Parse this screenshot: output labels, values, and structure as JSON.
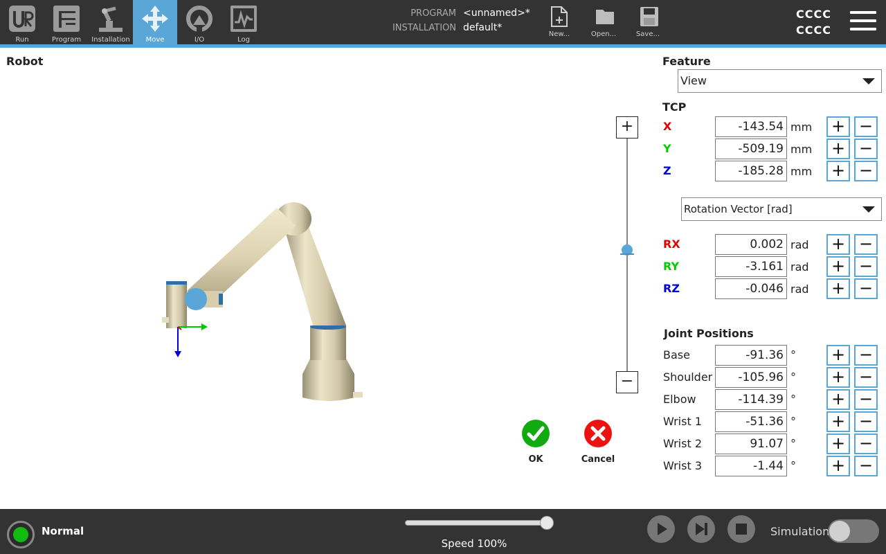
{
  "nav": {
    "items": [
      {
        "label": "Run"
      },
      {
        "label": "Program"
      },
      {
        "label": "Installation"
      },
      {
        "label": "Move"
      },
      {
        "label": "I/O"
      },
      {
        "label": "Log"
      }
    ]
  },
  "header": {
    "program_key": "PROGRAM",
    "program_value": "<unnamed>*",
    "installation_key": "INSTALLATION",
    "installation_value": "default*",
    "file_buttons": [
      {
        "label": "New..."
      },
      {
        "label": "Open..."
      },
      {
        "label": "Save..."
      }
    ],
    "user_line1": "CCCC",
    "user_line2": "CCCC"
  },
  "robot": {
    "title": "Robot"
  },
  "actions": {
    "ok_label": "OK",
    "cancel_label": "Cancel"
  },
  "feature": {
    "title": "Feature",
    "selected": "View"
  },
  "tcp": {
    "title": "TCP",
    "position": [
      {
        "axis": "X",
        "value": "-143.54",
        "unit": "mm"
      },
      {
        "axis": "Y",
        "value": "-509.19",
        "unit": "mm"
      },
      {
        "axis": "Z",
        "value": "-185.28",
        "unit": "mm"
      }
    ],
    "rotation_mode": "Rotation Vector [rad]",
    "rotation": [
      {
        "axis": "RX",
        "value": "0.002",
        "unit": "rad"
      },
      {
        "axis": "RY",
        "value": "-3.161",
        "unit": "rad"
      },
      {
        "axis": "RZ",
        "value": "-0.046",
        "unit": "rad"
      }
    ]
  },
  "joints": {
    "title": "Joint Positions",
    "items": [
      {
        "name": "Base",
        "value": "-91.36",
        "unit": "°"
      },
      {
        "name": "Shoulder",
        "value": "-105.96",
        "unit": "°"
      },
      {
        "name": "Elbow",
        "value": "-114.39",
        "unit": "°"
      },
      {
        "name": "Wrist 1",
        "value": "-51.36",
        "unit": "°"
      },
      {
        "name": "Wrist 2",
        "value": "91.07",
        "unit": "°"
      },
      {
        "name": "Wrist 3",
        "value": "-1.44",
        "unit": "°"
      }
    ]
  },
  "footer": {
    "status": "Normal",
    "speed_label": "Speed 100%",
    "speed_fraction": 1.0,
    "simulation_label": "Simulation"
  },
  "colors": {
    "accent": "#5aa6d6",
    "bar": "#333333",
    "x_axis": "#e00000",
    "y_axis": "#00cc00",
    "z_axis": "#0000dd",
    "ok": "#11aa11",
    "cancel": "#ee1111"
  }
}
